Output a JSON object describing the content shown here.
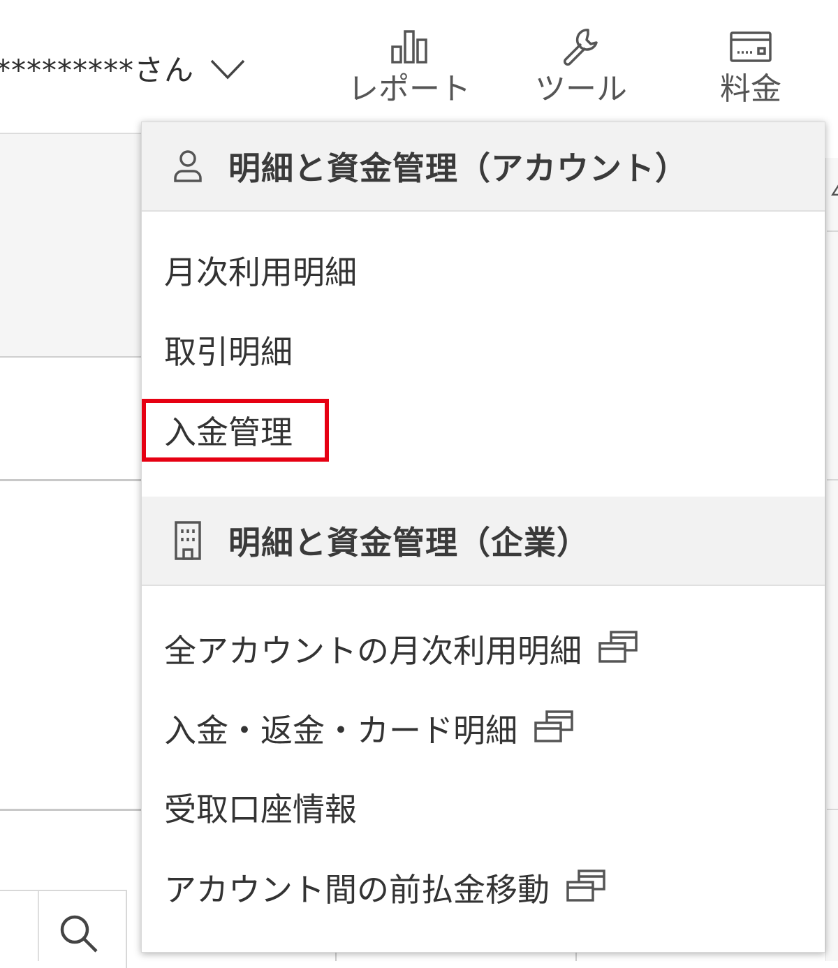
{
  "header": {
    "user_name": "*********さん",
    "nav": [
      {
        "label": "レポート",
        "icon": "bar-chart-icon"
      },
      {
        "label": "ツール",
        "icon": "wrench-icon"
      },
      {
        "label": "料金",
        "icon": "card-icon"
      }
    ]
  },
  "dropdown": {
    "sections": [
      {
        "title": "明細と資金管理（アカウント）",
        "icon": "user-icon",
        "items": [
          {
            "label": "月次利用明細",
            "external": false
          },
          {
            "label": "取引明細",
            "external": false
          },
          {
            "label": "入金管理",
            "external": false,
            "highlighted": true
          }
        ]
      },
      {
        "title": "明細と資金管理（企業）",
        "icon": "building-icon",
        "items": [
          {
            "label": "全アカウントの月次利用明細",
            "external": true
          },
          {
            "label": "入金・返金・カード明細",
            "external": true
          },
          {
            "label": "受取口座情報",
            "external": false
          },
          {
            "label": "アカウント間の前払金移動",
            "external": true
          }
        ]
      }
    ]
  },
  "colors": {
    "highlight": "#e60012",
    "section_bg": "#f2f2f2",
    "text": "#333333"
  },
  "background": {
    "search_icon": "search-icon"
  }
}
